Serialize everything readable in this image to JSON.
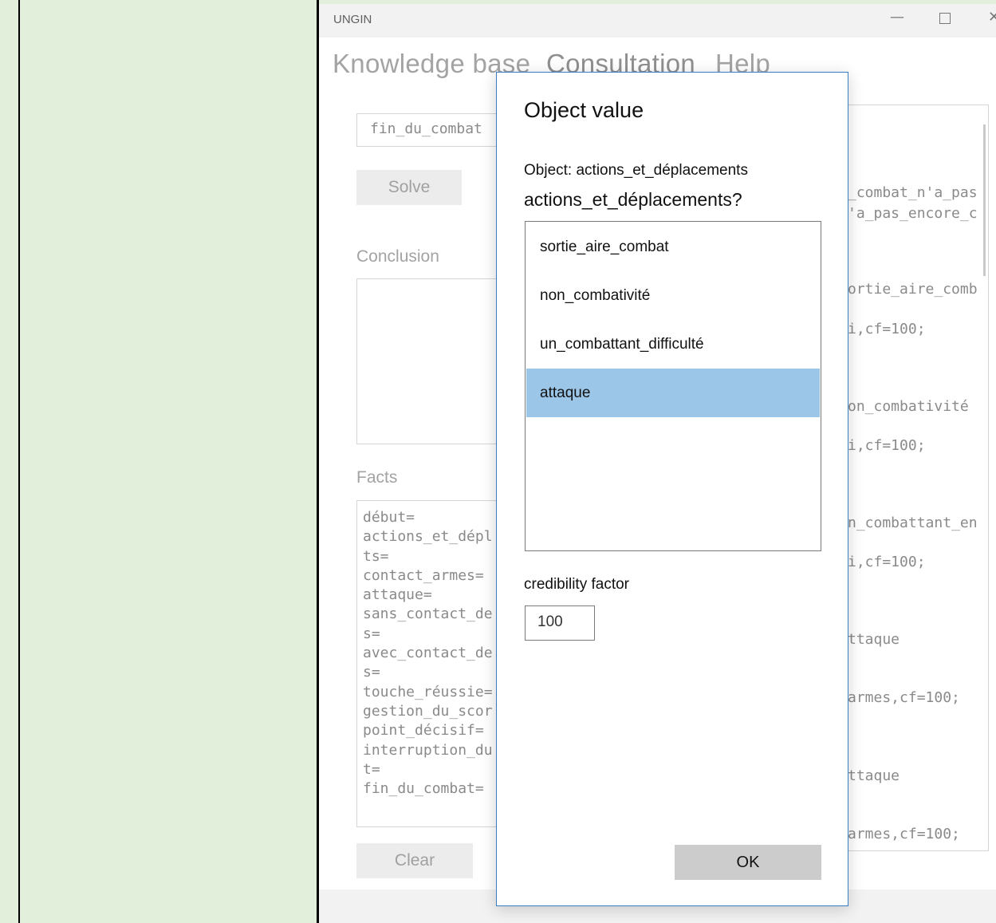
{
  "window": {
    "title": "UNGIN",
    "minimize_glyph": "—",
    "close_glyph": "✕"
  },
  "menu": {
    "items": [
      "Knowledge base",
      "Consultation",
      "Help"
    ]
  },
  "consultation": {
    "goal_value": "fin_du_combat",
    "solve_label": "Solve",
    "conclusion_label": "Conclusion",
    "facts_label": "Facts",
    "facts_lines": [
      "début=",
      "actions_et_dépl",
      "ts=",
      "contact_armes=",
      "attaque=",
      "sans_contact_de",
      "s=",
      "avec_contact_de",
      "s=",
      "touche_réussie=",
      "gestion_du_scor",
      "point_décisif=",
      "interruption_du",
      "t=",
      "fin_du_combat="
    ],
    "clear_label": "Clear",
    "rules_lines": [
      "_combat_n'a_pas",
      "'a_pas_encore_c",
      "ortie_aire_comb",
      "i,cf=100;",
      "on_combativité",
      "i,cf=100;",
      "n_combattant_en",
      "i,cf=100;",
      "ttaque",
      "armes,cf=100;",
      "ttaque",
      "armes,cf=100;"
    ]
  },
  "dialog": {
    "title": "Object value",
    "object_line": "Object:  actions_et_déplacements",
    "question": "actions_et_déplacements?",
    "options": [
      "sortie_aire_combat",
      "non_combativité",
      "un_combattant_difficulté",
      "attaque"
    ],
    "selected_option": "attaque",
    "cf_label": "credibility factor",
    "cf_value": "100",
    "ok_label": "OK",
    "accent_color": "#3a7cc2",
    "selection_color": "#9bc6e8"
  }
}
